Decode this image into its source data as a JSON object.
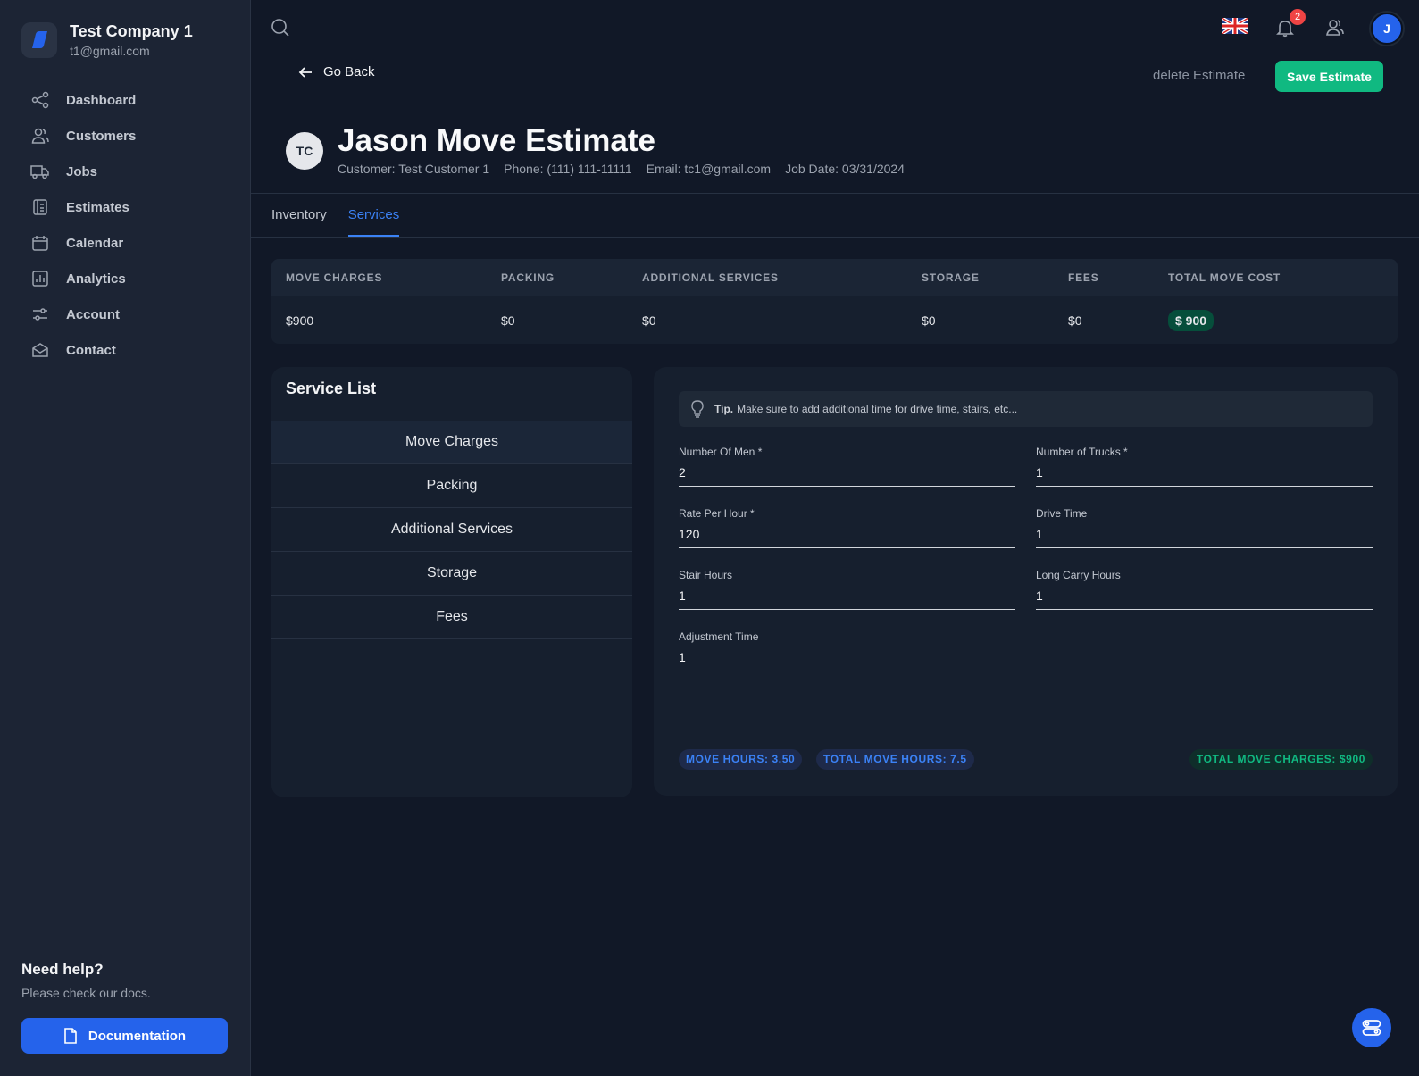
{
  "brand": {
    "name": "Test Company 1",
    "email": "t1@gmail.com"
  },
  "sidebar": {
    "items": [
      {
        "label": "Dashboard",
        "icon": "share-icon"
      },
      {
        "label": "Customers",
        "icon": "users-icon"
      },
      {
        "label": "Jobs",
        "icon": "truck-icon"
      },
      {
        "label": "Estimates",
        "icon": "document-icon"
      },
      {
        "label": "Calendar",
        "icon": "calendar-icon"
      },
      {
        "label": "Analytics",
        "icon": "chart-icon"
      },
      {
        "label": "Account",
        "icon": "sliders-icon"
      },
      {
        "label": "Contact",
        "icon": "mail-icon"
      }
    ],
    "help_title": "Need help?",
    "help_sub": "Please check our docs.",
    "doc_button": "Documentation"
  },
  "topbar": {
    "notification_count": "2",
    "avatar_initial": "J"
  },
  "actions": {
    "go_back": "Go Back",
    "delete": "delete Estimate",
    "save": "Save Estimate"
  },
  "estimate": {
    "initials": "TC",
    "title": "Jason Move Estimate",
    "customer": "Customer: Test Customer 1",
    "phone": "Phone: (111) 111-11111",
    "email": "Email: tc1@gmail.com",
    "job_date": "Job Date: 03/31/2024"
  },
  "tabs": [
    {
      "label": "Inventory"
    },
    {
      "label": "Services",
      "active": true
    }
  ],
  "summary": {
    "headers": [
      "MOVE CHARGES",
      "PACKING",
      "ADDITIONAL SERVICES",
      "STORAGE",
      "FEES",
      "TOTAL MOVE COST"
    ],
    "values": [
      "$900",
      "$0",
      "$0",
      "$0",
      "$0",
      "$ 900"
    ]
  },
  "service_list": {
    "title": "Service List",
    "items": [
      "Move Charges",
      "Packing",
      "Additional Services",
      "Storage",
      "Fees"
    ]
  },
  "form": {
    "tip_bold": "Tip.",
    "tip_text": "Make sure to add additional time for drive time, stairs, etc...",
    "fields": [
      {
        "label": "Number Of Men",
        "required": "*",
        "value": "2"
      },
      {
        "label": "Number of Trucks",
        "required": "*",
        "value": "1"
      },
      {
        "label": "Rate Per Hour",
        "required": "*",
        "value": "120"
      },
      {
        "label": "Drive Time",
        "required": "",
        "value": "1"
      },
      {
        "label": "Stair Hours",
        "required": "",
        "value": "1"
      },
      {
        "label": "Long Carry Hours",
        "required": "",
        "value": "1"
      },
      {
        "label": "Adjustment Time",
        "required": "",
        "value": "1"
      }
    ],
    "move_hours": "MOVE HOURS: 3.50",
    "total_move_hours": "TOTAL MOVE HOURS: 7.5",
    "total_move_charges": "TOTAL MOVE CHARGES: $900"
  },
  "colors": {
    "accent": "#2563eb",
    "success": "#10b981",
    "background": "#111827",
    "sidebar": "#1c2434"
  }
}
